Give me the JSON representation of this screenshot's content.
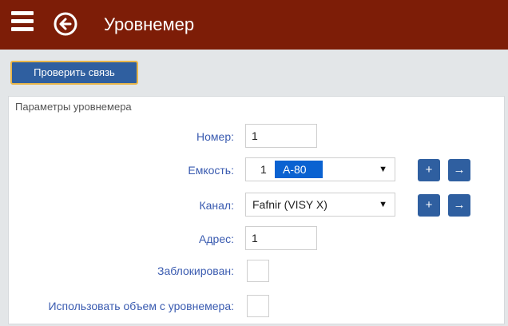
{
  "header": {
    "title": "Уровнемер",
    "menu_icon": "hamburger-menu-icon",
    "back_icon": "back-arrow-circle-icon",
    "background": "#7d1d07"
  },
  "toolbar": {
    "check_button_label": "Проверить связь",
    "button_color": "#2f5fa0",
    "button_border_color": "#e8b64a"
  },
  "panel": {
    "title": "Параметры уровнемера"
  },
  "fields": {
    "number": {
      "label": "Номер:",
      "value": "1"
    },
    "tank": {
      "label": "Емкость:",
      "value_num": "1",
      "value_name": "А-80",
      "add_label": "+",
      "go_label": "→"
    },
    "channel": {
      "label": "Канал:",
      "value": "Fafnir (VISY X)",
      "add_label": "+",
      "go_label": "→"
    },
    "address": {
      "label": "Адрес:",
      "value": "1"
    },
    "locked": {
      "label": "Заблокирован:",
      "checked": false
    },
    "use_volume": {
      "label": "Использовать объем с уровнемера:",
      "checked": false
    }
  }
}
